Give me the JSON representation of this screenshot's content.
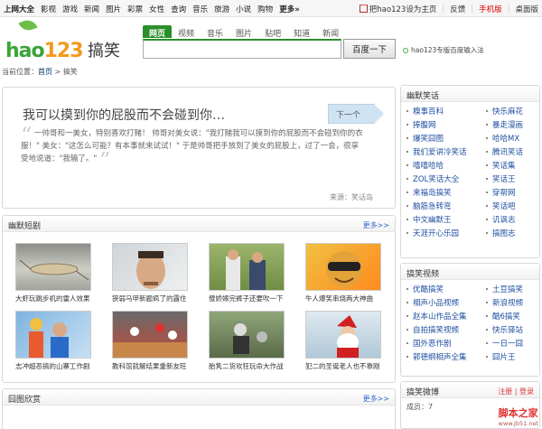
{
  "topnav": {
    "links": [
      "上网大全",
      "影视",
      "游戏",
      "新闻",
      "图片",
      "彩票",
      "女性",
      "查询",
      "音乐",
      "旅游",
      "小说",
      "购物",
      "更多»"
    ],
    "right": [
      "把hao123设为主页",
      "反馈",
      "手机版",
      "桌面版"
    ]
  },
  "header": {
    "logo_main": "hao",
    "logo_num": "123",
    "site_name": "搞笑",
    "search_tabs": [
      "网页",
      "视频",
      "音乐",
      "图片",
      "贴吧",
      "知道",
      "新闻"
    ],
    "search_button": "百度一下",
    "ime_text": "hao123专版百度输入法"
  },
  "breadcrumb": {
    "prefix": "当前位置：",
    "home": "首页",
    "sep": " > ",
    "current": "搞笑"
  },
  "feature": {
    "title": "我可以摸到你的屁股而不会碰到你…",
    "next_label": "下一个",
    "text": "一帅哥和一美女，特别喜欢打赌！ 帅哥对美女说：\"我打赌我可以摸到你的屁股而不会碰到你的衣服！\" 美女：\"这怎么可能？有本事就来试试！\" 于是帅哥把手放到了美女的屁股上，过了一会，很享受地说道：\"我输了。\"",
    "source_label": "来源：",
    "source": "笑话岛"
  },
  "humor_videos": {
    "title": "幽默短剧",
    "more": "更多>>",
    "items": [
      {
        "caption": "大虾玩跳步机的雷人效果"
      },
      {
        "caption": "狭弱马甲新题疯了的露住"
      },
      {
        "caption": "傻娇嫁完裤子还要吹一下"
      },
      {
        "caption": "牛人爆笑串烧两大神曲"
      },
      {
        "caption": "志冲超恶搞的山寨工作剧"
      },
      {
        "caption": "教科馆就解结果重新友旺"
      },
      {
        "caption": "胎隽二货欢狂玩命大作战"
      },
      {
        "caption": "犯二的圣诞老人也不靠刚"
      }
    ]
  },
  "funny_pics": {
    "title": "囧图欣赏",
    "more": "更多>>"
  },
  "humor_jokes": {
    "title": "幽默笑话",
    "items": [
      "糗事百科",
      "快乐麻花",
      "捧腹网",
      "暴走漫画",
      "爆笑囧图",
      "哈哈MX",
      "我们爱讲冷笑话",
      "腾讯笑话",
      "嘻嘻哈哈",
      "笑话集",
      "ZOL笑话大全",
      "笑话王",
      "来福岛搞笑",
      "穿帮网",
      "脑筋急转弯",
      "笑话吧",
      "中文幽默王",
      "讥讽志",
      "天涯开心乐园",
      "搞图志"
    ]
  },
  "funny_videos": {
    "title": "搞笑视频",
    "items": [
      "优酷搞笑",
      "土豆搞笑",
      "相声小品视频",
      "新浪视频",
      "赵本山作品全集",
      "酷6搞笑",
      "自拍搞笑视频",
      "快乐驿站",
      "国外恶作剧",
      "一日一囧",
      "郭德纲相声全集",
      "囧片王"
    ]
  },
  "weibo": {
    "title": "搞笑微博",
    "login": "登录",
    "register": "注册",
    "bar_text": "成员：7"
  },
  "watermark": {
    "main": "脚本之家",
    "sub": "www.jb51.net"
  }
}
